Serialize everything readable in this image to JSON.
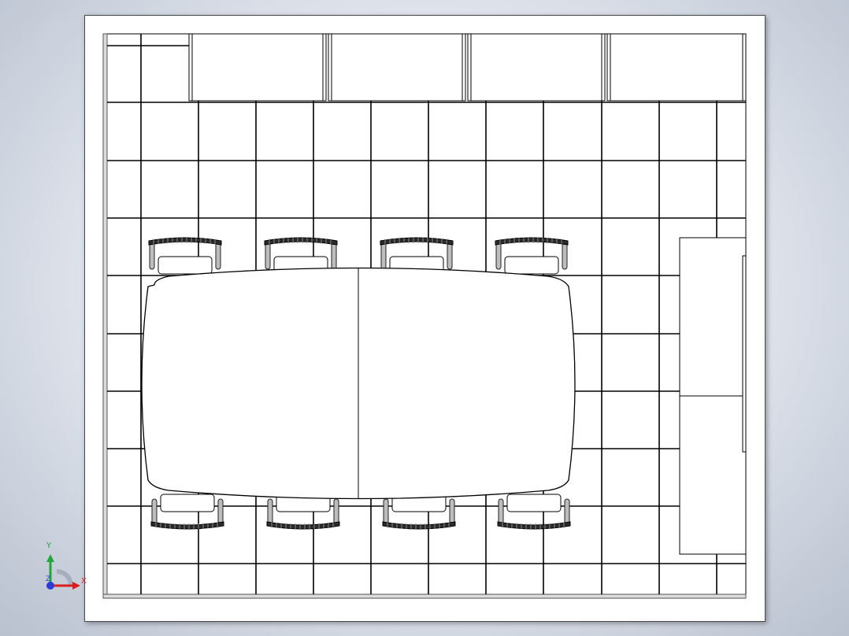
{
  "triad": {
    "x_label": "X",
    "y_label": "Y",
    "z_label": "Z",
    "x_icon": "x-axis-arrow-icon",
    "y_icon": "y-axis-arrow-icon",
    "z_icon": "z-axis-point-icon"
  },
  "colors": {
    "background_center": "#f4f6fa",
    "background_edge": "#b9c1cf",
    "sheet": "#ffffff",
    "line": "#000000",
    "chair_back": "#2b2b2b",
    "x_axis": "#d81e1e",
    "y_axis": "#1fa838",
    "z_axis": "#2a3dd8"
  }
}
